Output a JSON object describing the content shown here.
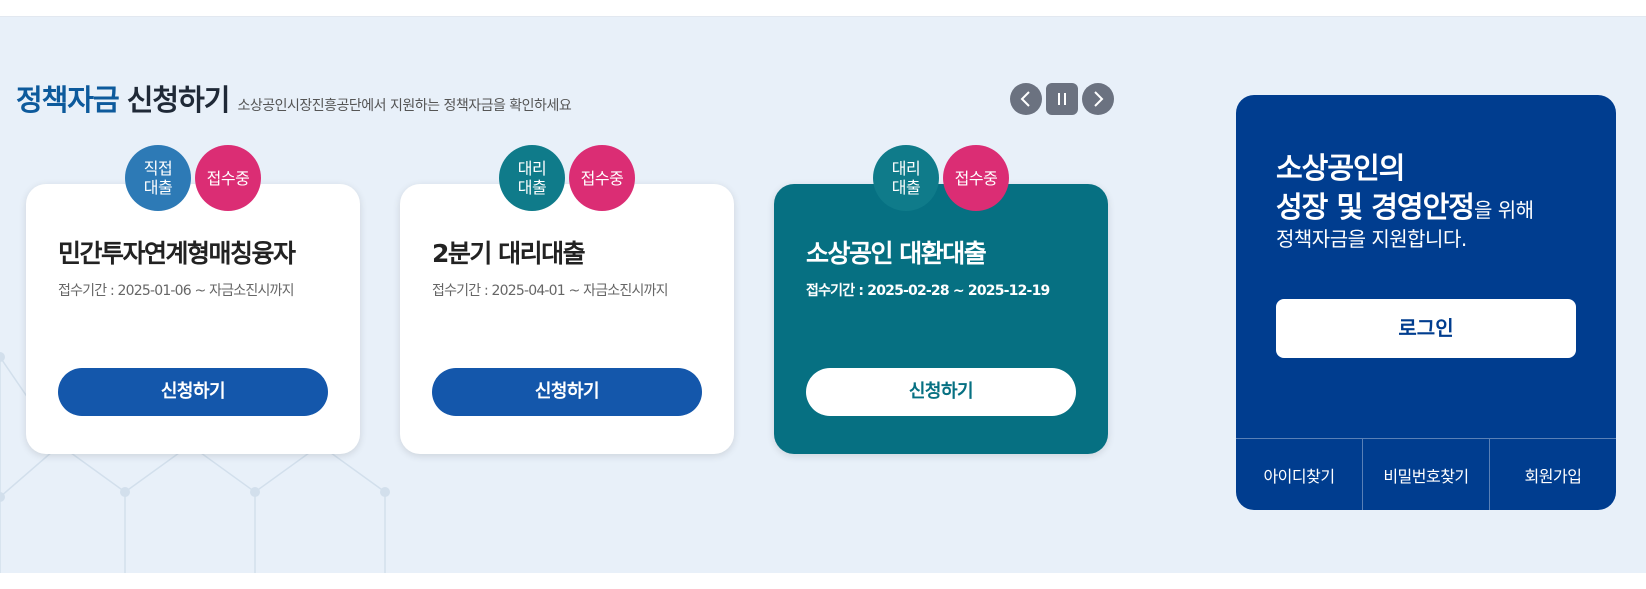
{
  "heading": {
    "title_strong": "정책자금",
    "title_rest": "신청하기",
    "subtitle": "소상공인시장진흥공단에서 지원하는 정책자금을 확인하세요"
  },
  "slider": {
    "prev_icon": "chevron-left-icon",
    "pause_icon": "pause-icon",
    "next_icon": "chevron-right-icon"
  },
  "cards": [
    {
      "type_badge": "직접\n대출",
      "status_badge": "접수중",
      "title": "민간투자연계형매칭융자",
      "period": "접수기간 : 2025-01-06 ~ 자금소진시까지",
      "button": "신청하기"
    },
    {
      "type_badge": "대리\n대출",
      "status_badge": "접수중",
      "title": "2분기 대리대출",
      "period": "접수기간 : 2025-04-01 ~ 자금소진시까지",
      "button": "신청하기"
    },
    {
      "type_badge": "대리\n대출",
      "status_badge": "접수중",
      "title": "소상공인 대환대출",
      "period": "접수기간 : 2025-02-28 ~ 2025-12-19",
      "button": "신청하기"
    }
  ],
  "login_panel": {
    "line1": "소상공인의",
    "line2_em": "성장 및 경영안정",
    "line2_rest": "을 위해",
    "line3": "정책자금을 지원합니다.",
    "login_button": "로그인",
    "links": [
      "아이디찾기",
      "비밀번호찾기",
      "회원가입"
    ]
  },
  "colors": {
    "brand_blue": "#003d8f",
    "button_blue": "#1457ab",
    "teal": "#067082",
    "status_pink": "#db2d74",
    "section_bg": "#e8f0f9"
  }
}
